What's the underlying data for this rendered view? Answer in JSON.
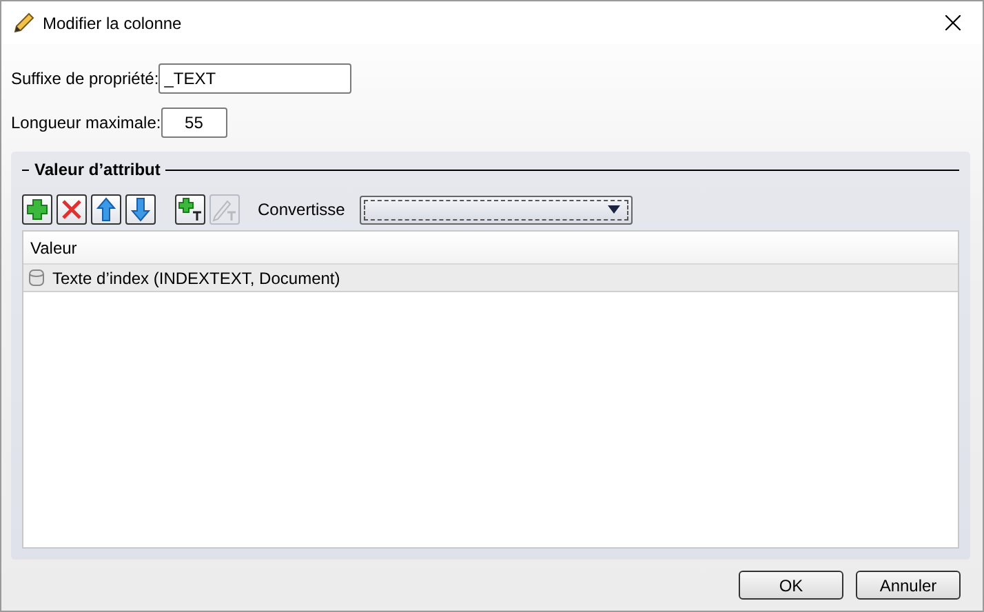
{
  "window": {
    "title": "Modifier la colonne"
  },
  "fields": [
    {
      "label": "Suffixe de propriété:",
      "value": "_TEXT",
      "kind": "wide"
    },
    {
      "label": "Longueur maximale:",
      "value": "55",
      "kind": "narrow"
    }
  ],
  "group": {
    "title": "Valeur d’attribut",
    "toolbar": [
      {
        "kind": "add",
        "disabled": false
      },
      {
        "kind": "delete",
        "disabled": false
      },
      {
        "kind": "up",
        "disabled": false
      },
      {
        "kind": "down",
        "disabled": false
      },
      {
        "kind": "add-text",
        "disabled": false
      },
      {
        "kind": "edit-text",
        "disabled": true
      }
    ],
    "convert_label": "Convertisse",
    "table": {
      "columns": [
        "Valeur"
      ],
      "rows": [
        {
          "text": "Texte d’index (INDEXTEXT, Document)",
          "selected": true
        }
      ]
    }
  },
  "buttons": [
    "OK",
    "Annuler"
  ]
}
